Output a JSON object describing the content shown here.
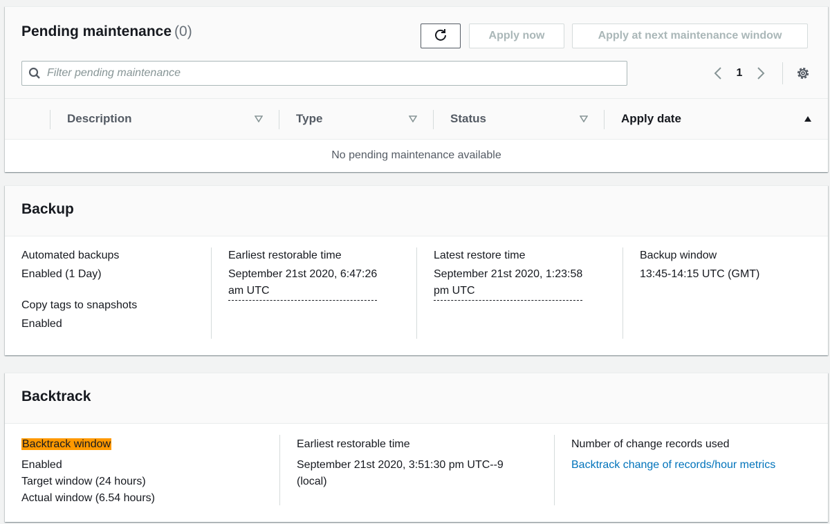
{
  "pending_maintenance": {
    "title": "Pending maintenance",
    "count": "(0)",
    "buttons": {
      "apply_now": "Apply now",
      "apply_next_window": "Apply at next maintenance window"
    },
    "filter_placeholder": "Filter pending maintenance",
    "pagination": {
      "current_page": "1"
    },
    "columns": [
      {
        "label": "Description"
      },
      {
        "label": "Type"
      },
      {
        "label": "Status"
      },
      {
        "label": "Apply date"
      }
    ],
    "empty_message": "No pending maintenance available"
  },
  "backup": {
    "title": "Backup",
    "automated_backups": {
      "label": "Automated backups",
      "value": "Enabled (1 Day)"
    },
    "copy_tags": {
      "label": "Copy tags to snapshots",
      "value": "Enabled"
    },
    "earliest_restorable": {
      "label": "Earliest restorable time",
      "line1": "September 21st 2020, 6:47:26",
      "line2": "am UTC"
    },
    "latest_restore": {
      "label": "Latest restore time",
      "line1": "September 21st 2020, 1:23:58",
      "line2": "pm UTC"
    },
    "backup_window": {
      "label": "Backup window",
      "value": "13:45-14:15 UTC (GMT)"
    }
  },
  "backtrack": {
    "title": "Backtrack",
    "window": {
      "label": "Backtrack window",
      "status": "Enabled",
      "target": "Target window (24 hours)",
      "actual": "Actual window (6.54 hours)"
    },
    "earliest_restorable": {
      "label": "Earliest restorable time",
      "line1": "September 21st 2020, 3:51:30 pm UTC--9",
      "line2": "(local)"
    },
    "change_records": {
      "label": "Number of change records used",
      "link": "Backtrack change of records/hour metrics"
    }
  },
  "colors": {
    "highlight": "#ff9900",
    "link": "#0073bb",
    "text": "#16191f",
    "muted": "#687078",
    "disabled": "#aab7b8"
  },
  "icons": [
    "refresh-icon",
    "search-icon",
    "chevron-left-icon",
    "chevron-right-icon",
    "gear-icon",
    "sort-down-icon",
    "sort-up-icon"
  ]
}
